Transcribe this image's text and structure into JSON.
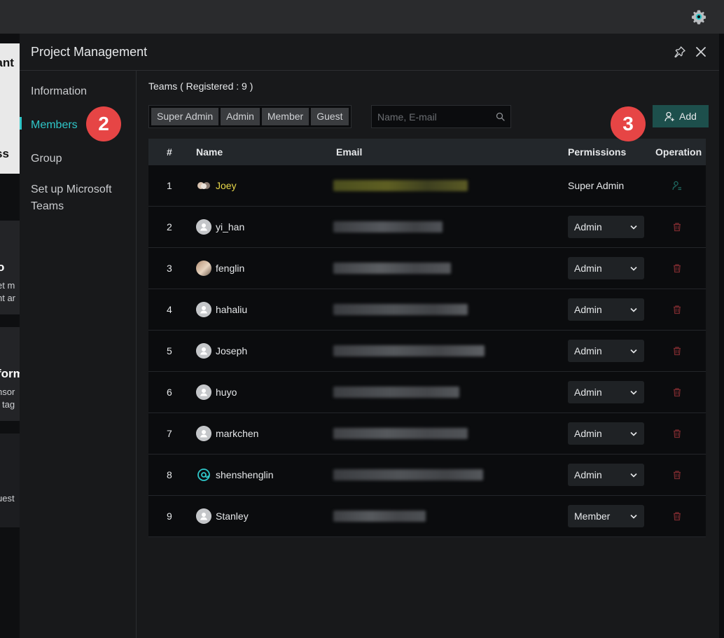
{
  "background_app": {
    "card1_text": "nant",
    "card1_sub": "ss",
    "card2_title": "o",
    "card2_line1": "et m",
    "card2_line2": "nt ar",
    "card3_title": "form",
    "card3_line1": "nsor",
    "card3_line2": "tag",
    "card4_line1": "uest"
  },
  "modal": {
    "title": "Project Management"
  },
  "nav": {
    "items": [
      {
        "label": "Information"
      },
      {
        "label": "Members"
      },
      {
        "label": "Group"
      },
      {
        "label": "Set up Microsoft Teams"
      }
    ],
    "active_index": 1
  },
  "badges": {
    "members": "2",
    "add": "3"
  },
  "teams": {
    "title": "Teams ( Registered : 9 )"
  },
  "filters": [
    "Super Admin",
    "Admin",
    "Member",
    "Guest"
  ],
  "search": {
    "placeholder": "Name, E-mail"
  },
  "add_button": {
    "label": "Add"
  },
  "table": {
    "headers": [
      "#",
      "Name",
      "Email",
      "Permissions",
      "Operation"
    ],
    "rows": [
      {
        "index": "1",
        "name": "Joey",
        "permission": "Super Admin",
        "avatar": "group-photo",
        "editable": false,
        "operation": "manage-user-icon"
      },
      {
        "index": "2",
        "name": "yi_han",
        "permission": "Admin",
        "avatar": "default",
        "editable": true,
        "operation": "trash-icon"
      },
      {
        "index": "3",
        "name": "fenglin",
        "permission": "Admin",
        "avatar": "photo",
        "editable": true,
        "operation": "trash-icon"
      },
      {
        "index": "4",
        "name": "hahaliu",
        "permission": "Admin",
        "avatar": "default",
        "editable": true,
        "operation": "trash-icon"
      },
      {
        "index": "5",
        "name": "Joseph",
        "permission": "Admin",
        "avatar": "default",
        "editable": true,
        "operation": "trash-icon"
      },
      {
        "index": "6",
        "name": "huyo",
        "permission": "Admin",
        "avatar": "default",
        "editable": true,
        "operation": "trash-icon"
      },
      {
        "index": "7",
        "name": "markchen",
        "permission": "Admin",
        "avatar": "default",
        "editable": true,
        "operation": "trash-icon"
      },
      {
        "index": "8",
        "name": "shenshenglin",
        "permission": "Admin",
        "avatar": "at-logo",
        "editable": true,
        "operation": "trash-icon"
      },
      {
        "index": "9",
        "name": "Stanley",
        "permission": "Member",
        "avatar": "default",
        "editable": true,
        "operation": "trash-icon"
      }
    ]
  },
  "colors": {
    "accent": "#2fc7c9",
    "highlight_name": "#e8d84a",
    "badge_red": "#e64545",
    "add_button_bg": "#1d4f4c",
    "trash_red": "#7a2a2e"
  },
  "icons": {
    "top_bar": "gear-icon",
    "header": [
      "pin-icon",
      "close-icon"
    ],
    "search": "search-icon",
    "add": "add-user-icon",
    "select": "chevron-down-icon"
  }
}
